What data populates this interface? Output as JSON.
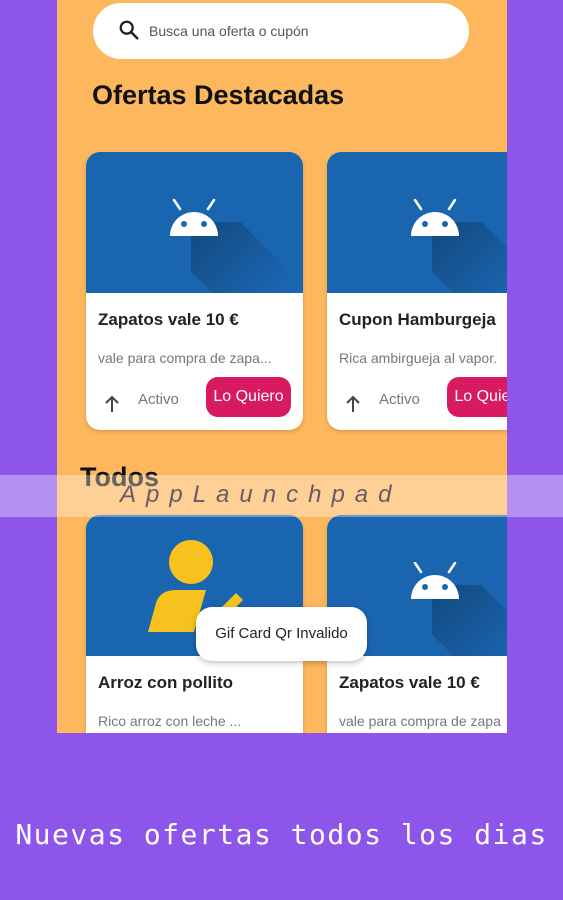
{
  "search": {
    "placeholder": "Busca una oferta o cupón"
  },
  "featured": {
    "title": "Ofertas Destacadas",
    "cards": [
      {
        "title": "Zapatos vale 10 €",
        "desc": "vale para compra de zapa...",
        "status": "Activo",
        "button": "Lo Quiero",
        "image": "android-icon"
      },
      {
        "title": "Cupon Hamburgeja",
        "desc": "Rica ambirgueja al vapor.",
        "status": "Activo",
        "button": "Lo Quiero",
        "image": "android-icon"
      }
    ]
  },
  "all": {
    "title": "Todos",
    "cards": [
      {
        "title": "Arroz con pollito",
        "desc": "Rico arroz con leche ...",
        "image": "person-icon"
      },
      {
        "title": "Zapatos vale 10 €",
        "desc": "vale para compra de zapa",
        "image": "android-icon"
      }
    ]
  },
  "toast": {
    "text": "Gif Card Qr Invalido"
  },
  "watermark": {
    "text": "AppLaunchpad"
  },
  "footer": {
    "text": "Nuevas ofertas todos los dias"
  },
  "colors": {
    "background": "#8e55ea",
    "app_bg": "#fdb75c",
    "card_image": "#1a65b0",
    "accent": "#d81b60"
  }
}
